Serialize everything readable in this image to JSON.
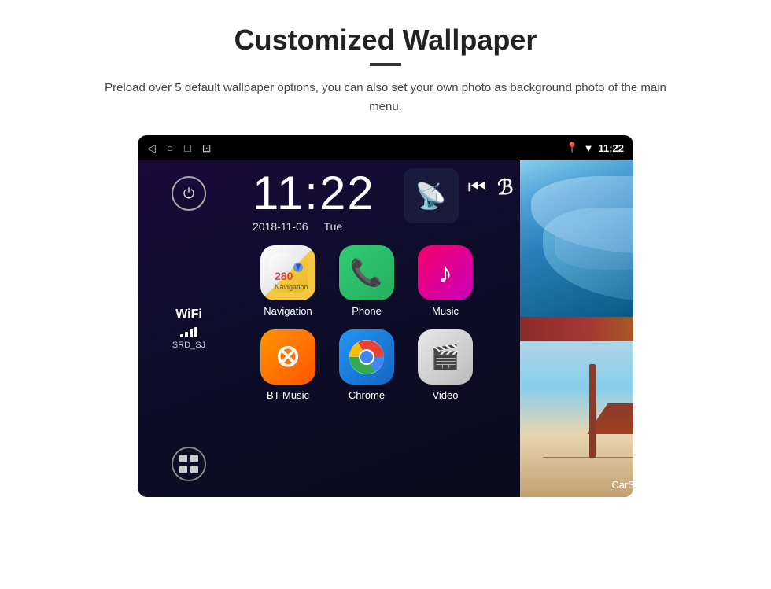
{
  "page": {
    "title": "Customized Wallpaper",
    "subtitle": "Preload over 5 default wallpaper options, you can also set your own photo as background photo of the main menu."
  },
  "device": {
    "status_bar": {
      "nav_back": "◁",
      "nav_home": "○",
      "nav_recent": "□",
      "nav_screenshot": "⊡",
      "location_icon": "📍",
      "wifi_icon": "▼",
      "time": "11:22"
    },
    "clock": {
      "time": "11:22",
      "date": "2018-11-06",
      "day": "Tue"
    },
    "sidebar": {
      "power_icon": "⏻",
      "wifi_label": "WiFi",
      "wifi_ssid": "SRD_SJ",
      "apps_icon": "⊞"
    },
    "apps": [
      {
        "id": "navigation",
        "label": "Navigation",
        "icon_type": "navigation"
      },
      {
        "id": "phone",
        "label": "Phone",
        "icon_type": "phone"
      },
      {
        "id": "music",
        "label": "Music",
        "icon_type": "music"
      },
      {
        "id": "btmusic",
        "label": "BT Music",
        "icon_type": "btmusic"
      },
      {
        "id": "chrome",
        "label": "Chrome",
        "icon_type": "chrome"
      },
      {
        "id": "video",
        "label": "Video",
        "icon_type": "video"
      }
    ],
    "media_icons": {
      "prev": "⏮",
      "next": "ℬ"
    },
    "wallpapers": [
      {
        "id": "ice",
        "type": "ice",
        "label": ""
      },
      {
        "id": "bridge",
        "type": "bridge",
        "label": "CarSetting"
      }
    ]
  }
}
